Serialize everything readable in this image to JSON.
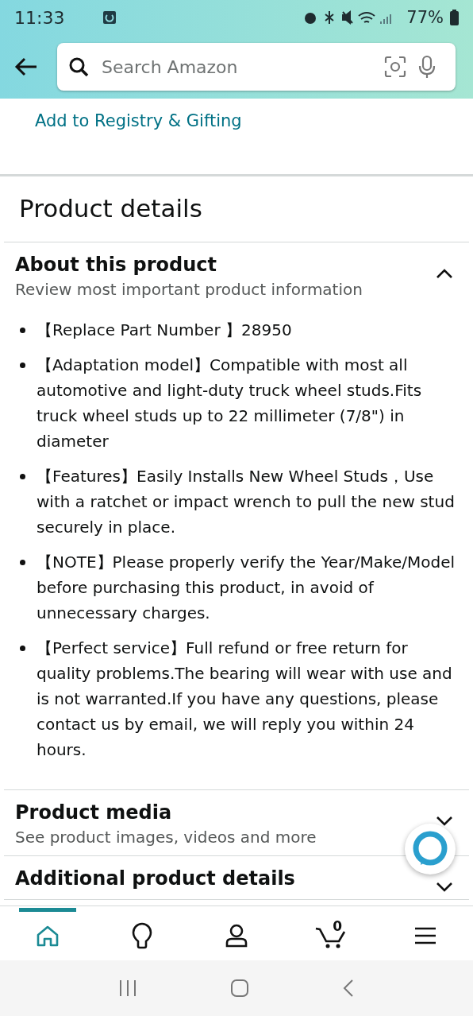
{
  "status_bar": {
    "time": "11:33",
    "battery": "77%"
  },
  "search": {
    "placeholder": "Search Amazon"
  },
  "registry_link": "Add to Registry & Gifting",
  "section_title": "Product details",
  "sections": [
    {
      "title": "About this product",
      "subtitle": "Review most important product information",
      "expanded": true,
      "bullets": [
        "【Replace Part Number 】28950",
        "【Adaptation model】Compatible with most all automotive and light-duty truck wheel studs.Fits truck wheel studs up to 22 millimeter (7/8\") in diameter",
        "【Features】Easily Installs New Wheel Studs，Use with a ratchet or impact wrench to pull the new stud securely in place.",
        "【NOTE】Please properly verify the Year/Make/Model before purchasing this product, in avoid of unnecessary charges.",
        "【Perfect service】Full refund or free return for quality problems.The bearing will wear with use and is not warranted.If you have any questions, please contact us by email, we will reply you within 24 hours."
      ]
    },
    {
      "title": "Product media",
      "subtitle": "See product images, videos and more",
      "expanded": false
    },
    {
      "title": "Additional product details",
      "expanded": false
    }
  ],
  "nav": [
    {
      "kind": "home",
      "selected": true
    },
    {
      "kind": "ideas",
      "selected": false
    },
    {
      "kind": "account",
      "selected": false
    },
    {
      "kind": "cart",
      "selected": false,
      "count": "0"
    },
    {
      "kind": "menu",
      "selected": false
    }
  ]
}
